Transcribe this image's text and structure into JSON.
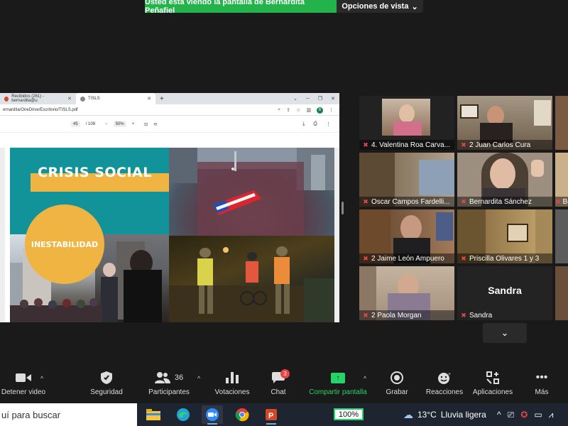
{
  "banner": {
    "sharing_text": "Usted está viendo la pantalla de Bernardita Peñafiel",
    "options_label": "Opciones de vista"
  },
  "browser": {
    "tab1_title": "Recibidos (261) - bernardita@u",
    "tab2_title": "TISLS",
    "new_tab": "+",
    "address": "ernardita/OneDrive/Escritorio/TISLS.pdf",
    "profile_initial": "B"
  },
  "pdf": {
    "page_current": "45",
    "page_total": "/ 108",
    "zoom": "50%"
  },
  "slide": {
    "title": "CRISIS SOCIAL",
    "circle_text": "INESTABILIDAD"
  },
  "participants": [
    {
      "name": "4. Valentina Roa Carva...",
      "muted": true
    },
    {
      "name": "2 Juan Carlos Cura",
      "muted": true
    },
    {
      "name": "Oscar Campos Fardelli...",
      "muted": true
    },
    {
      "name": "Bernardita Sánchez",
      "muted": true,
      "active": true
    },
    {
      "name": "Be",
      "muted": true
    },
    {
      "name": "2 Jaime León Ampuero",
      "muted": true
    },
    {
      "name": "Priscilla Olivares 1 y 3",
      "muted": true
    },
    {
      "name": "2 Paola Morgan",
      "muted": true
    },
    {
      "name": "Sandra",
      "muted": true,
      "big_name": "Sandra"
    }
  ],
  "toolbar": {
    "video_label": "Detener video",
    "security_label": "Seguridad",
    "participants_label": "Participantes",
    "participants_count": "36",
    "polls_label": "Votaciones",
    "chat_label": "Chat",
    "chat_badge": "3",
    "share_label": "Compartir pantalla",
    "record_label": "Grabar",
    "reactions_label": "Reacciones",
    "apps_label": "Aplicaciones",
    "more_label": "Más"
  },
  "taskbar": {
    "search_placeholder": "uí para buscar",
    "battery_text": "100%",
    "weather_temp": "13°C",
    "weather_desc": "Lluvia ligera"
  }
}
